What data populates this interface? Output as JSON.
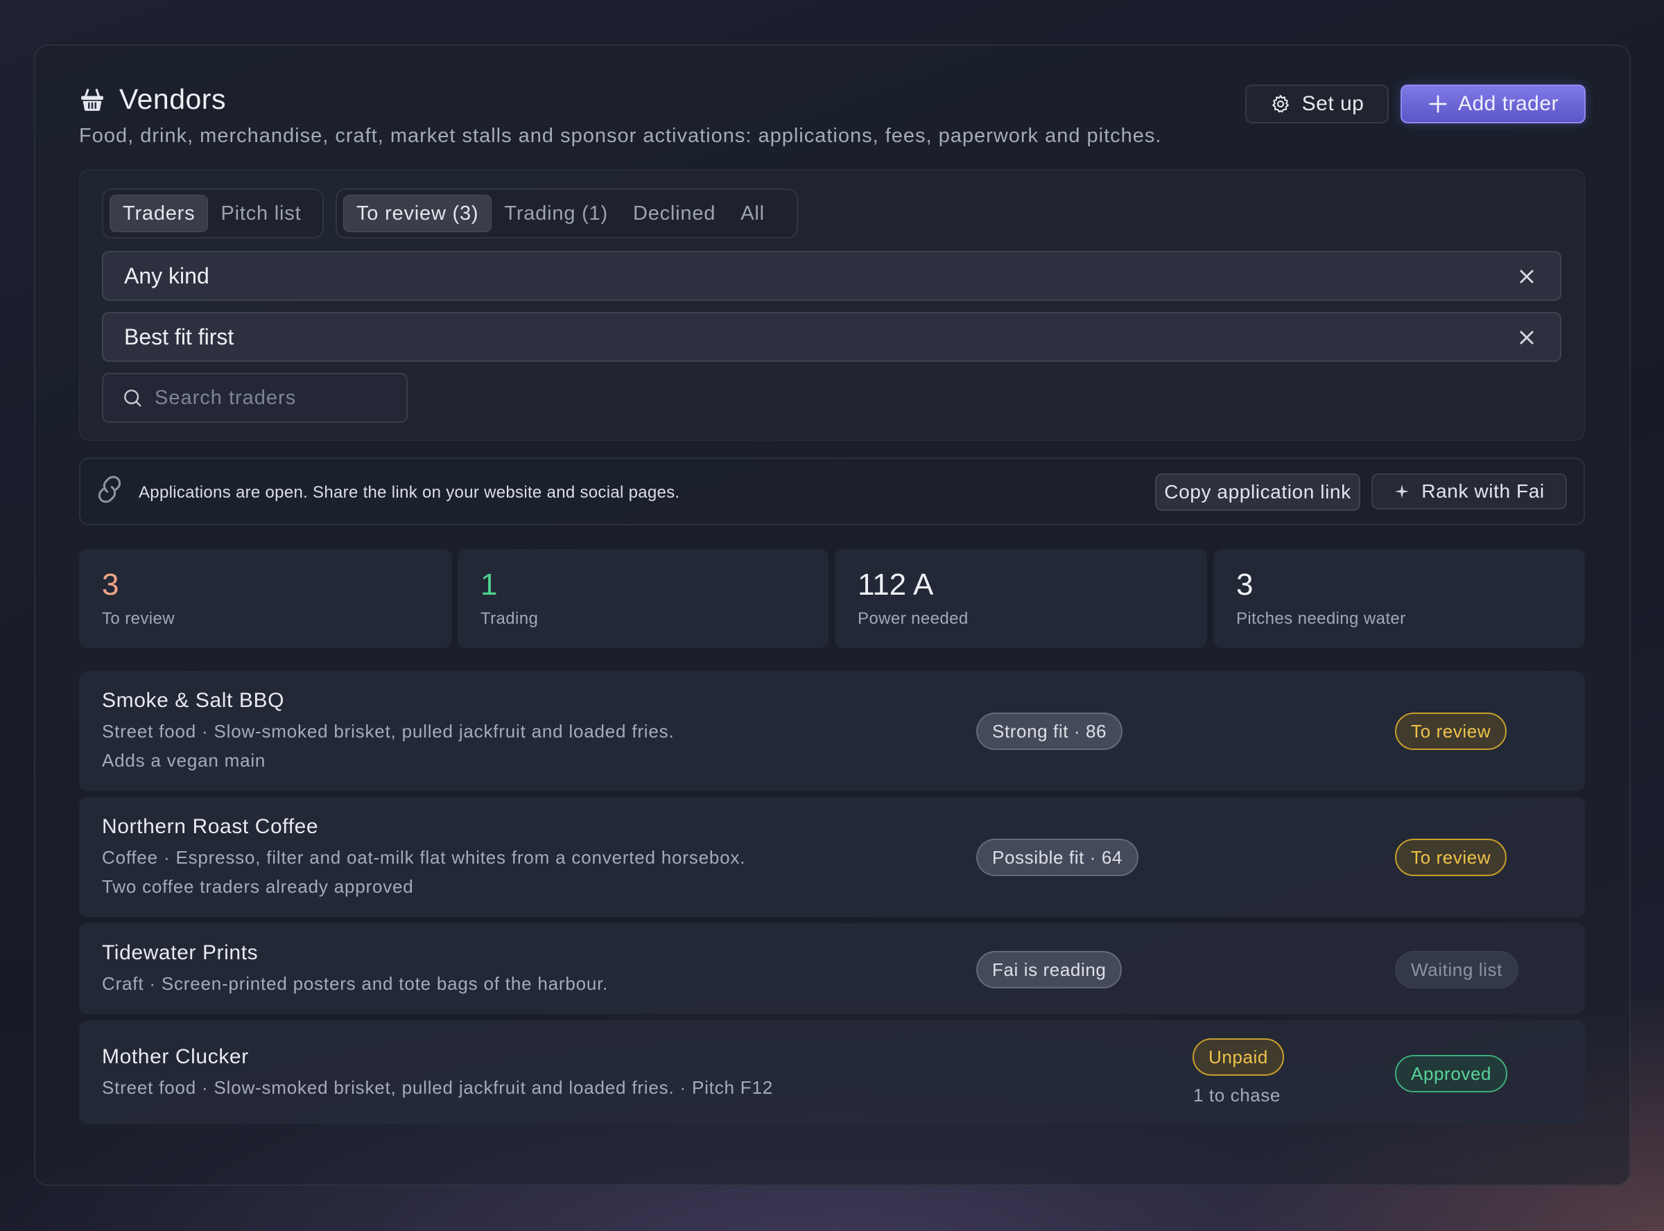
{
  "header": {
    "icon": "basket-icon",
    "title": "Vendors",
    "subtitle": "Food, drink, merchandise, craft, market stalls and sponsor activations: applications, fees, paperwork and pitches.",
    "setup_label": "Set up",
    "add_label": "Add trader"
  },
  "view_tabs": [
    {
      "label": "Traders",
      "active": true
    },
    {
      "label": "Pitch list",
      "active": false
    }
  ],
  "status_tabs": [
    {
      "label": "To review (3)",
      "active": true
    },
    {
      "label": "Trading (1)",
      "active": false
    },
    {
      "label": "Declined",
      "active": false
    },
    {
      "label": "All",
      "active": false
    }
  ],
  "filters": {
    "kind_value": "Any kind",
    "sort_value": "Best fit first",
    "search_placeholder": "Search traders"
  },
  "banner": {
    "text": "Applications are open. Share the link on your website and social pages.",
    "copy_label": "Copy application link",
    "rank_label": "Rank with Fai"
  },
  "stats": [
    {
      "value": "3",
      "label": "To review",
      "color": "#f0a487"
    },
    {
      "value": "1",
      "label": "Trading",
      "color": "#4fd08e"
    },
    {
      "value": "112 A",
      "label": "Power needed",
      "color": "#eef0f5"
    },
    {
      "value": "3",
      "label": "Pitches needing water",
      "color": "#eef0f5"
    }
  ],
  "traders": [
    {
      "name": "Smoke & Salt BBQ",
      "description": "Street food · Slow-smoked brisket, pulled jackfruit and loaded fries.",
      "note": "Adds a vegan main",
      "fit": "Strong fit · 86",
      "status": "To review"
    },
    {
      "name": "Northern Roast Coffee",
      "description": "Coffee · Espresso, filter and oat-milk flat whites from a converted horsebox.",
      "note": "Two coffee traders already approved",
      "fit": "Possible fit · 64",
      "status": "To review"
    },
    {
      "name": "Tidewater Prints",
      "description": "Craft · Screen-printed posters and tote bags of the harbour.",
      "fit": "Fai is reading",
      "status": "Waiting list"
    },
    {
      "name": "Mother Clucker",
      "description": "Street food · Slow-smoked brisket, pulled jackfruit and loaded fries. · Pitch F12",
      "payment": "Unpaid",
      "chase": "1 to chase",
      "status": "Approved"
    }
  ],
  "colors": {
    "accent": "#6f69dc",
    "review": "#f1c34a",
    "approved": "#59d39a"
  }
}
